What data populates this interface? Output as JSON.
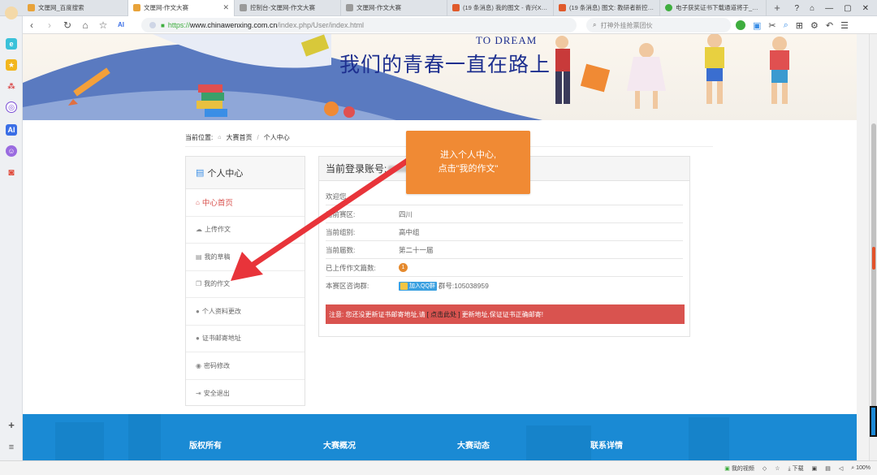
{
  "browser": {
    "tabs": [
      {
        "title": "文厘网_百度搜索",
        "active": false,
        "color": "#e8a33a"
      },
      {
        "title": "文厘网-作文大赛",
        "active": true,
        "color": "#e8a33a"
      },
      {
        "title": "控制台-文厘网-作文大赛",
        "active": false,
        "color": "#e8a33a"
      },
      {
        "title": "文厘网-作文大赛",
        "active": false,
        "color": "#8a8a8a"
      },
      {
        "title": "(19 条消息) 我的图文 - 青兴X…",
        "active": false,
        "color": "#e05a2b"
      },
      {
        "title": "(19 条消息) 图文: 教研者新控…",
        "active": false,
        "color": "#e05a2b"
      },
      {
        "title": "电子获奖证书下载通道将于_36…",
        "active": false,
        "color": "#3fae3f"
      }
    ],
    "url_prefix": "https://",
    "url_host": "www.chinawenxing.com.cn",
    "url_path": "/index.php/User/index.html",
    "search_placeholder": "打神外挂抢票团伙",
    "zoom": "100%"
  },
  "status": {
    "video": "我的视频",
    "download": "下载"
  },
  "banner": {
    "slogan": "我们的青春一直在路上",
    "to_dream": "TO DREAM"
  },
  "breadcrumb": {
    "label": "当前位置:",
    "home": "大赛首页",
    "current": "个人中心"
  },
  "sidebar": {
    "title": "个人中心",
    "items": [
      {
        "label": "中心首页",
        "icon": "home-icon",
        "active": true
      },
      {
        "label": "上传作文",
        "icon": "cloud-upload-icon",
        "active": false
      },
      {
        "label": "我的草稿",
        "icon": "draft-icon",
        "active": false
      },
      {
        "label": "我的作文",
        "icon": "copy-icon",
        "active": false
      },
      {
        "label": "个人资料更改",
        "icon": "user-icon",
        "active": false
      },
      {
        "label": "证书邮寄地址",
        "icon": "user-icon",
        "active": false
      },
      {
        "label": "密码修改",
        "icon": "comment-icon",
        "active": false
      },
      {
        "label": "安全退出",
        "icon": "logout-icon",
        "active": false
      }
    ]
  },
  "panel": {
    "title": "当前登录账号:",
    "welcome": "欢迎您",
    "rows": [
      {
        "label": "当前赛区:",
        "value": "四川"
      },
      {
        "label": "当前组别:",
        "value": "高中组"
      },
      {
        "label": "当前届数:",
        "value": "第二十一届"
      },
      {
        "label": "已上传作文篇数:",
        "value": "1"
      },
      {
        "label": "本赛区咨询群:",
        "qq_button": "加入QQ群",
        "value": "群号:105038959"
      }
    ],
    "warning_pre": "注意: 您还没更新证书邮寄地址,请",
    "warning_link": "[ 点击此处 ]",
    "warning_post": "更新地址,保证证书正确邮寄!"
  },
  "callout": {
    "line1": "进入个人中心,",
    "line2": "点击\"我的作文\""
  },
  "footer": {
    "cols": [
      "版权所有",
      "大赛概况",
      "大赛动态",
      "联系详情"
    ]
  },
  "colors": {
    "accent_red": "#d9534f",
    "callout_orange": "#f08a34",
    "footer_blue": "#1a8ad4",
    "arrow_red": "#e8343a"
  }
}
